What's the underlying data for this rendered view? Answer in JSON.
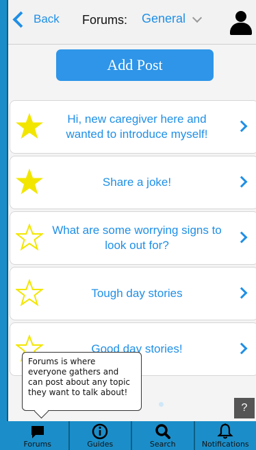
{
  "header": {
    "back_label": "Back",
    "forums_label": "Forums:",
    "category": "General"
  },
  "add_post_label": "Add Post",
  "posts": [
    {
      "title": "Hi, new caregiver here and wanted to introduce myself!",
      "starred": true
    },
    {
      "title": "Share a joke!",
      "starred": true
    },
    {
      "title": "What are some worrying signs to look out for?",
      "starred": false
    },
    {
      "title": "Tough day stories",
      "starred": false
    },
    {
      "title": "Good day stories!",
      "starred": false
    }
  ],
  "tooltip": "Forums is where everyone gathers and can post about any topic they want to talk about!",
  "help_label": "?",
  "tabs": [
    {
      "label": "Forums",
      "icon": "chat-icon"
    },
    {
      "label": "Guides",
      "icon": "info-icon"
    },
    {
      "label": "Search",
      "icon": "search-icon"
    },
    {
      "label": "Notifications",
      "icon": "bell-icon"
    }
  ],
  "colors": {
    "accent": "#1f8fe6",
    "frame": "#1b8ec9",
    "star": "#f2e600"
  }
}
